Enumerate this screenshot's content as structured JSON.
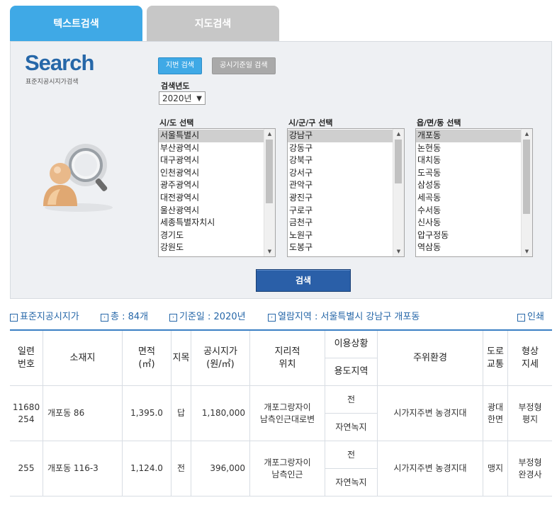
{
  "tabs": {
    "text_search": "텍스트검색",
    "map_search": "지도검색"
  },
  "logo": {
    "title": "Search",
    "subtitle": "표준지공시지가검색"
  },
  "buttons": {
    "jibun": "지번 검색",
    "date": "공시기준일 검색",
    "search": "검색"
  },
  "year": {
    "label": "검색년도",
    "value": "2020년"
  },
  "lists": {
    "sido": {
      "label": "시/도 선택",
      "items": [
        "서울특별시",
        "부산광역시",
        "대구광역시",
        "인천광역시",
        "광주광역시",
        "대전광역시",
        "울산광역시",
        "세종특별자치시",
        "경기도",
        "강원도"
      ],
      "selected": 0
    },
    "sigungu": {
      "label": "시/군/구 선택",
      "items": [
        "강남구",
        "강동구",
        "강북구",
        "강서구",
        "관악구",
        "광진구",
        "구로구",
        "금천구",
        "노원구",
        "도봉구"
      ],
      "selected": 0
    },
    "dong": {
      "label": "읍/면/동 선택",
      "items": [
        "개포동",
        "논현동",
        "대치동",
        "도곡동",
        "삼성동",
        "세곡동",
        "수서동",
        "신사동",
        "압구정동",
        "역삼동"
      ],
      "selected": 0
    }
  },
  "info": {
    "title": "표준지공시지가",
    "total": "총 : 84개",
    "date": "기준일 : 2020년",
    "region": "열람지역 : 서울특별시 강남구 개포동",
    "print": "인쇄"
  },
  "table": {
    "headers": {
      "serial": "일련\n번호",
      "address": "소재지",
      "area": "면적\n(㎡)",
      "landcat": "지목",
      "price": "공시지가\n(원/㎡)",
      "geo": "지리적\n위치",
      "usage": "이용상황",
      "zone": "용도지역",
      "env": "주위환경",
      "road": "도로\n교통",
      "shape": "형상\n지세"
    },
    "rows": [
      {
        "serial": "11680\n254",
        "address": "개포동 86",
        "area": "1,395.0",
        "landcat": "답",
        "price": "1,180,000",
        "geo": "개포그랑자이\n남측인근대로변",
        "usage": "전",
        "zone": "자연녹지",
        "env": "시가지주변 농경지대",
        "road": "광대\n한면",
        "shape": "부정형\n평지"
      },
      {
        "serial": "255",
        "address": "개포동 116-3",
        "area": "1,124.0",
        "landcat": "전",
        "price": "396,000",
        "geo": "개포그랑자이\n남측인근",
        "usage": "전",
        "zone": "자연녹지",
        "env": "시가지주변 농경지대",
        "road": "맹지",
        "shape": "부정형\n완경사"
      }
    ]
  }
}
